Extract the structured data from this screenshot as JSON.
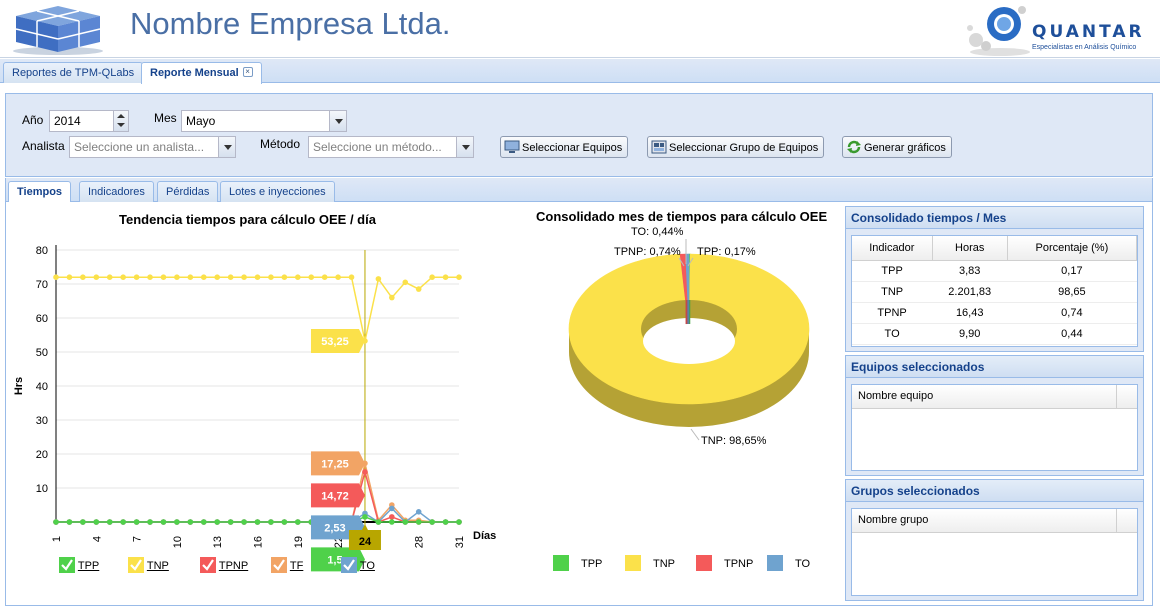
{
  "header": {
    "company": "Nombre Empresa Ltda.",
    "brand": "QUANTAR",
    "tagline": "Especialistas en Análisis Químico"
  },
  "main_tabs": [
    {
      "label": "Reportes de TPM-QLabs",
      "active": false
    },
    {
      "label": "Reporte Mensual",
      "active": true,
      "close": "×"
    }
  ],
  "filters": {
    "year_label": "Año",
    "year_value": "2014",
    "month_label": "Mes",
    "month_value": "Mayo",
    "analyst_label": "Analista",
    "analyst_placeholder": "Seleccione un analista...",
    "method_label": "Método",
    "method_placeholder": "Seleccione un método...",
    "btn_select_equipment": "Seleccionar Equipos",
    "btn_select_group": "Seleccionar Grupo de Equipos",
    "btn_generate": "Generar gráficos"
  },
  "sub_tabs": [
    {
      "label": "Tiempos",
      "active": true
    },
    {
      "label": "Indicadores",
      "active": false
    },
    {
      "label": "Pérdidas",
      "active": false
    },
    {
      "label": "Lotes e inyecciones",
      "active": false
    }
  ],
  "trend_chart": {
    "title": "Tendencia tiempos para cálculo OEE / día",
    "ylabel": "Hrs",
    "xlabel": "Días",
    "highlight_day": "24",
    "callouts": [
      {
        "series": "TNP",
        "value": "53,25",
        "color": "#fbe14a",
        "text_color": "#ffffff"
      },
      {
        "series": "TF",
        "value": "17,25",
        "color": "#f2a465",
        "text_color": "#ffffff"
      },
      {
        "series": "TPNP",
        "value": "14,72",
        "color": "#f45a5a",
        "text_color": "#ffffff"
      },
      {
        "series": "TO",
        "value": "2,53",
        "color": "#6fa3cf",
        "text_color": "#ffffff"
      },
      {
        "series": "TPP",
        "value": "1,5",
        "color": "#4fd14a",
        "text_color": "#ffffff"
      }
    ],
    "legend": [
      {
        "label": "TPP",
        "color": "#4fd14a"
      },
      {
        "label": "TNP",
        "color": "#fbe14a"
      },
      {
        "label": "TPNP",
        "color": "#f45a5a"
      },
      {
        "label": "TF",
        "color": "#f2a465"
      },
      {
        "label": "TO",
        "color": "#6fa3cf"
      }
    ]
  },
  "chart_data": [
    {
      "type": "line",
      "title": "Tendencia tiempos para cálculo OEE / día",
      "xlabel": "Días",
      "ylabel": "Hrs",
      "xlim": [
        1,
        31
      ],
      "ylim": [
        0,
        80
      ],
      "yticks": [
        10,
        20,
        30,
        40,
        50,
        60,
        70,
        80
      ],
      "xticks": [
        1,
        4,
        7,
        10,
        13,
        16,
        19,
        22,
        24,
        28,
        31
      ],
      "grid": true,
      "x": [
        1,
        2,
        3,
        4,
        5,
        6,
        7,
        8,
        9,
        10,
        11,
        12,
        13,
        14,
        15,
        16,
        17,
        18,
        19,
        20,
        21,
        22,
        23,
        24,
        25,
        26,
        27,
        28,
        29,
        30,
        31
      ],
      "series": [
        {
          "name": "TNP",
          "color": "#fbe14a",
          "values": [
            72,
            72,
            72,
            72,
            72,
            72,
            72,
            72,
            72,
            72,
            72,
            72,
            72,
            72,
            72,
            72,
            72,
            72,
            72,
            72,
            72,
            72,
            72,
            53.25,
            71.5,
            66,
            70.5,
            68.5,
            72,
            72,
            72
          ]
        },
        {
          "name": "TF",
          "color": "#f2a465",
          "values": [
            0,
            0,
            0,
            0,
            0,
            0,
            0,
            0,
            0,
            0,
            0,
            0,
            0,
            0,
            0,
            0,
            0,
            0,
            0,
            0,
            0,
            0,
            0,
            17.25,
            0.5,
            5,
            0.5,
            0.5,
            0,
            0,
            0
          ]
        },
        {
          "name": "TPNP",
          "color": "#f45a5a",
          "values": [
            0,
            0,
            0,
            0,
            0,
            0,
            0,
            0,
            0,
            0,
            0,
            0,
            0,
            0,
            0,
            0,
            0,
            0,
            0,
            0,
            0,
            0,
            0,
            14.72,
            0,
            1.5,
            0,
            0,
            0,
            0,
            0
          ]
        },
        {
          "name": "TO",
          "color": "#6fa3cf",
          "values": [
            0,
            0,
            0,
            0,
            0,
            0,
            0,
            0,
            0,
            0,
            0,
            0,
            0,
            0,
            0,
            0,
            0,
            0,
            0,
            0,
            0,
            0,
            0,
            2.53,
            0,
            4,
            0,
            3,
            0,
            0,
            0
          ]
        },
        {
          "name": "TPP",
          "color": "#4fd14a",
          "values": [
            0,
            0,
            0,
            0,
            0,
            0,
            0,
            0,
            0,
            0,
            0,
            0,
            0,
            0,
            0,
            0,
            0,
            0,
            0,
            0,
            0,
            0,
            0,
            1.5,
            0,
            0,
            0,
            0,
            0,
            0,
            0
          ]
        }
      ],
      "legend_position": "bottom"
    },
    {
      "type": "pie",
      "title": "Consolidado mes de tiempos para cálculo OEE",
      "donut": true,
      "categories": [
        "TPP",
        "TNP",
        "TPNP",
        "TO"
      ],
      "values": [
        0.17,
        98.65,
        0.74,
        0.44
      ],
      "colors": [
        "#4fd14a",
        "#fbe14a",
        "#f45a5a",
        "#6fa3cf"
      ],
      "labels": [
        "TPP: 0,17%",
        "TNP: 98,65%",
        "TPNP: 0,74%",
        "TO: 0,44%"
      ],
      "legend_position": "bottom"
    }
  ],
  "consolidated": {
    "title": "Consolidado tiempos / Mes",
    "headers": [
      "Indicador",
      "Horas",
      "Porcentaje (%)"
    ],
    "rows": [
      [
        "TPP",
        "3,83",
        "0,17"
      ],
      [
        "TNP",
        "2.201,83",
        "98,65"
      ],
      [
        "TPNP",
        "16,43",
        "0,74"
      ],
      [
        "TO",
        "9,90",
        "0,44"
      ]
    ]
  },
  "equipment_panel": {
    "title": "Equipos seleccionados",
    "column": "Nombre equipo"
  },
  "groups_panel": {
    "title": "Grupos seleccionados",
    "column": "Nombre grupo"
  }
}
